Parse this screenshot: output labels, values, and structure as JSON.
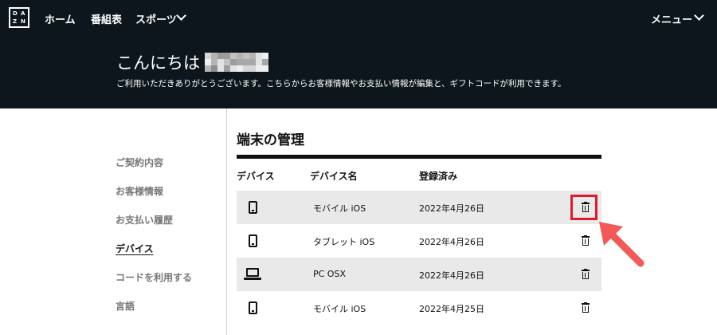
{
  "topnav": {
    "logo_letters": [
      "D",
      "A",
      "Z",
      "N"
    ],
    "home": "ホーム",
    "schedule": "番組表",
    "sports": "スポーツ",
    "menu": "メニュー"
  },
  "hero": {
    "greeting": "こんにちは",
    "subtitle": "ご利用いただきありがとうございます。こちらからお客様情報やお支払い情報が編集と、ギフトコードが利用できます。"
  },
  "sidebar": {
    "items": [
      {
        "label": "ご契約内容",
        "active": false
      },
      {
        "label": "お客様情報",
        "active": false
      },
      {
        "label": "お支払い履歴",
        "active": false
      },
      {
        "label": "デバイス",
        "active": true
      },
      {
        "label": "コードを利用する",
        "active": false
      },
      {
        "label": "言語",
        "active": false
      }
    ]
  },
  "main": {
    "title": "端末の管理",
    "columns": [
      "デバイス",
      "デバイス名",
      "登録済み"
    ],
    "rows": [
      {
        "icon": "phone-icon",
        "name": "モバイル iOS",
        "date": "2022年4月26日",
        "highlighted": true
      },
      {
        "icon": "phone-icon",
        "name": "タブレット iOS",
        "date": "2022年4月26日",
        "highlighted": false
      },
      {
        "icon": "laptop-icon",
        "name": "PC OSX",
        "date": "2022年4月26日",
        "highlighted": false
      },
      {
        "icon": "phone-icon",
        "name": "モバイル iOS",
        "date": "2022年4月25日",
        "highlighted": false
      }
    ]
  },
  "colors": {
    "header_bg": "#0c161c",
    "row_alt_bg": "#e9e9e9",
    "highlight": "#e0192b",
    "arrow": "#f25a5a"
  }
}
